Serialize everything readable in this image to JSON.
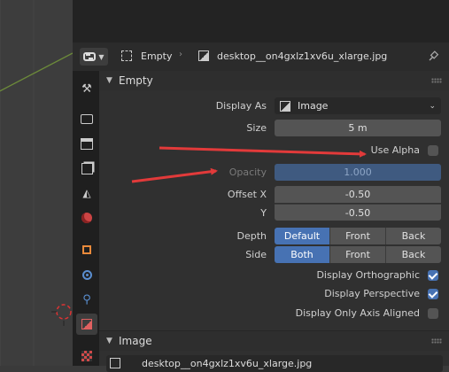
{
  "header": {
    "object_name": "Empty",
    "image_name": "desktop__on4gxlz1xv6u_xlarge.jpg"
  },
  "empty_panel": {
    "title": "Empty",
    "display_as_label": "Display As",
    "display_as_value": "Image",
    "size_label": "Size",
    "size_value": "5 m",
    "use_alpha_label": "Use Alpha",
    "use_alpha_checked": false,
    "opacity_label": "Opacity",
    "opacity_value": "1.000",
    "offset_x_label": "Offset X",
    "offset_x_value": "-0.50",
    "offset_y_label": "Y",
    "offset_y_value": "-0.50",
    "depth_label": "Depth",
    "depth_options": [
      "Default",
      "Front",
      "Back"
    ],
    "depth_selected": "Default",
    "side_label": "Side",
    "side_options": [
      "Both",
      "Front",
      "Back"
    ],
    "side_selected": "Both",
    "display_ortho_label": "Display Orthographic",
    "display_ortho_checked": true,
    "display_persp_label": "Display Perspective",
    "display_persp_checked": true,
    "axis_aligned_label": "Display Only Axis Aligned",
    "axis_aligned_checked": false
  },
  "image_panel": {
    "title": "Image",
    "image_name": "desktop__on4gxlz1xv6u_xlarge.jpg"
  },
  "colors": {
    "accent": "#4772b3",
    "annotation_arrow": "#e23a3a"
  }
}
